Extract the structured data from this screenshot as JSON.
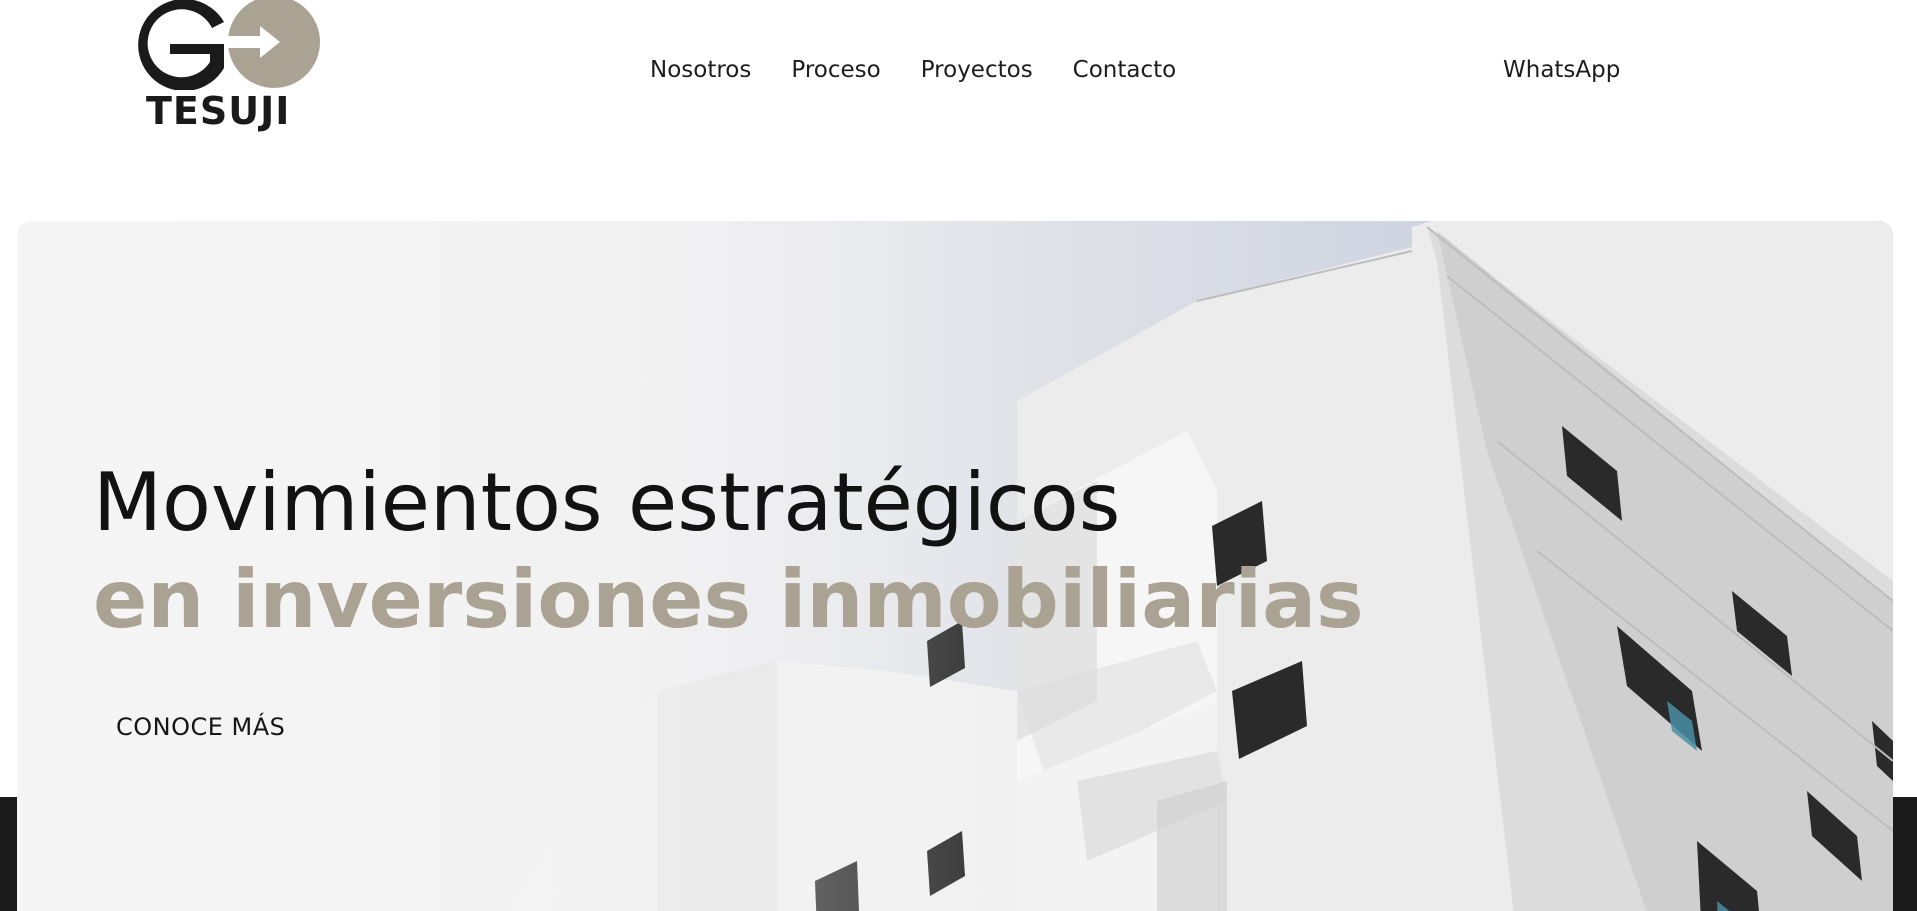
{
  "brand": {
    "name": "TESUJI",
    "colors": {
      "accent": "#aaa292",
      "dark": "#1a1a1a",
      "sky": "#b9c2da"
    }
  },
  "nav": {
    "items": [
      {
        "label": "Nosotros"
      },
      {
        "label": "Proceso"
      },
      {
        "label": "Proyectos"
      },
      {
        "label": "Contacto"
      }
    ],
    "cta_label": "WhatsApp"
  },
  "hero": {
    "title": "Movimientos estratégicos",
    "subtitle": "en inversiones inmobiliarias",
    "button_label": "CONOCE MÁS"
  }
}
